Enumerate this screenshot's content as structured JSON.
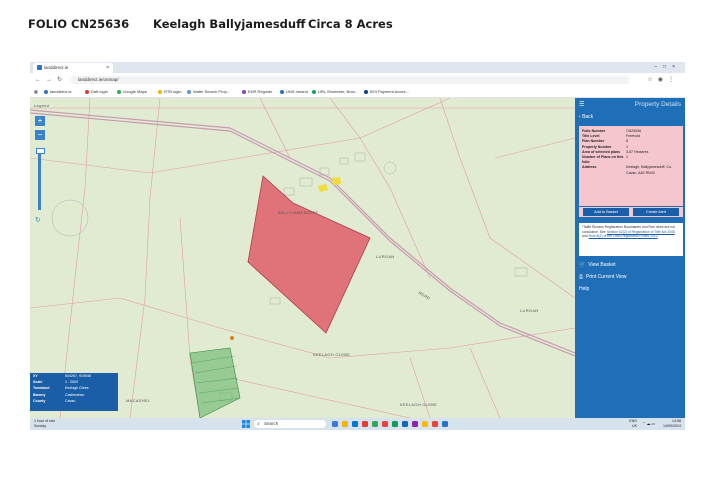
{
  "header": {
    "folio": "FOLIO CN25636",
    "location": "Keelagh Ballyjamesduff",
    "acreage": "Circa 8 Acres"
  },
  "browser": {
    "tab_title": "landdirect.ie",
    "url": "landdirect.ie/onmap/",
    "bookmarks": [
      {
        "label": "landdirect.ie",
        "color": "#2a73c5"
      },
      {
        "label": "Daft login",
        "color": "#e53935"
      },
      {
        "label": "Google Maps",
        "color": "#34a853"
      },
      {
        "label": "RTB login",
        "color": "#f4b400"
      },
      {
        "label": "Water Search Prop...",
        "color": "#5b9bd5"
      },
      {
        "label": "EDR Register",
        "color": "#8e44ad"
      },
      {
        "label": "UNS Ireland",
        "color": "#2a73c5"
      },
      {
        "label": "URL Shortener, Bran...",
        "color": "#1aa260"
      },
      {
        "label": "BOI Payment Acces...",
        "color": "#0b3d91"
      }
    ]
  },
  "map": {
    "legend_label": "Legend",
    "labels": {
      "lurgan1": "LURGAN",
      "lurgan2": "LURGAN",
      "glebe1": "KEELAGH GLEBE",
      "glebe2": "KEELAGH GLEBE",
      "road": "ROAD",
      "macashel": "MACASHEL",
      "bally": "BALLYJAMESDUFF"
    },
    "info": [
      {
        "k": "XY",
        "v": "604267, 919546"
      },
      {
        "k": "Scale",
        "v": "1 : 2500"
      },
      {
        "k": "Townland",
        "v": "Keelagh Glebe"
      },
      {
        "k": "Barony",
        "v": "Castlerahan"
      },
      {
        "k": "County",
        "v": "Cavan"
      }
    ]
  },
  "panel": {
    "title": "Property Details",
    "back": "Back",
    "details": [
      {
        "k": "Folio Number",
        "v": "CN25636"
      },
      {
        "k": "Title Level",
        "v": "Freehold"
      },
      {
        "k": "Plan Number",
        "v": "8"
      },
      {
        "k": "Property Number",
        "v": "1"
      },
      {
        "k": "Area of selected plans",
        "v": "3.87 Hectares"
      },
      {
        "k": "Number of Plans on this folio",
        "v": "1"
      },
      {
        "k": "Address",
        "v": "Keelagh, Ballyjamesduff, Co. Cavan, A82 RN43"
      }
    ],
    "add_basket": "Add to Basket",
    "create_alert": "Create Alert",
    "disclaimer_pre": "*Tailte Éireann Registration Boundaries and Ran nices are not conclusive. See",
    "disclaimer_link1": "Section 62(2) of Registration of Title Act 2006",
    "disclaimer_mid": "and",
    "disclaimer_link2": "Rule 8(2) of the Land Registration Rules 2012",
    "view_basket": "View Basket",
    "print_view": "Print Current View",
    "help": "Help"
  },
  "taskbar": {
    "weather1": "1 hour of rain",
    "weather2": "Sunday",
    "search": "Search",
    "lang1": "ENG",
    "lang2": "UK",
    "time": "14:58",
    "date": "14/09/2024",
    "icon_colors": [
      "#3a7bd5",
      "#f4b400",
      "#0078d4",
      "#e53935",
      "#34a853",
      "#ea4335",
      "#0f9d58",
      "#1565c0",
      "#8e24aa",
      "#fbbc05",
      "#ea4335",
      "#2a73c5"
    ]
  }
}
